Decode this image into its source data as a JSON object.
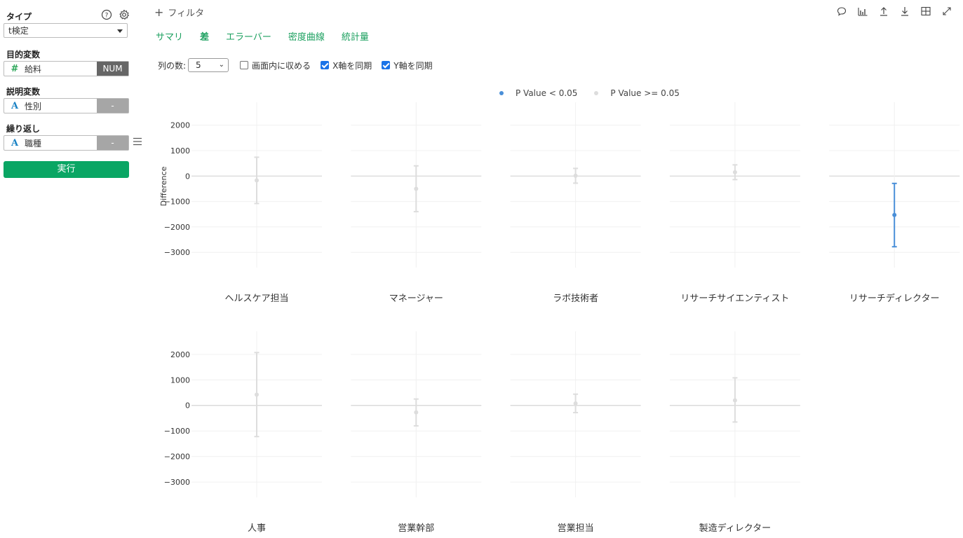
{
  "sidebar": {
    "type_label": "タイプ",
    "type_value": "t検定",
    "target_label": "目的変数",
    "target_field": {
      "name": "給料",
      "tag": "NUM",
      "icon": "#"
    },
    "explanatory_label": "説明変数",
    "explanatory_field": {
      "name": "性別",
      "tag": "-",
      "icon": "A"
    },
    "repeat_label": "繰り返し",
    "repeat_field": {
      "name": "職種",
      "tag": "-",
      "icon": "A"
    },
    "run_label": "実行"
  },
  "filter_label": "フィルタ",
  "tabs": [
    {
      "label": "サマリ",
      "active": false
    },
    {
      "label": "差",
      "active": true
    },
    {
      "label": "エラーバー",
      "active": false
    },
    {
      "label": "密度曲線",
      "active": false
    },
    {
      "label": "統計量",
      "active": false
    }
  ],
  "controls": {
    "columns_label": "列の数:",
    "columns_value": "5",
    "fit_screen_label": "画面内に収める",
    "fit_screen_checked": false,
    "sync_x_label": "X軸を同期",
    "sync_x_checked": true,
    "sync_y_label": "Y軸を同期",
    "sync_y_checked": true
  },
  "legend": [
    {
      "label": "P Value < 0.05",
      "color": "#4a8fd8"
    },
    {
      "label": "P Value >= 0.05",
      "color": "#dddddd"
    }
  ],
  "colors": {
    "significant": "#4a8fd8",
    "not_significant": "#dddddd",
    "accent": "#0aa664"
  },
  "chart_data": {
    "type": "errorbar",
    "ylabel": "Difference",
    "yticks": [
      2000,
      1000,
      0,
      -1000,
      -2000,
      -3000
    ],
    "ytick_labels": [
      "2000",
      "1000",
      "0",
      "−1000",
      "−2000",
      "−3000"
    ],
    "ylim": [
      -3600,
      2900
    ],
    "columns": 5,
    "facets": [
      {
        "name": "ヘルスケア担当",
        "mean": -170,
        "lower": -1080,
        "upper": 740,
        "significant": false
      },
      {
        "name": "マネージャー",
        "mean": -500,
        "lower": -1400,
        "upper": 400,
        "significant": false
      },
      {
        "name": "ラボ技術者",
        "mean": 10,
        "lower": -280,
        "upper": 300,
        "significant": false
      },
      {
        "name": "リサーチサイエンティスト",
        "mean": 150,
        "lower": -140,
        "upper": 440,
        "significant": false
      },
      {
        "name": "リサーチディレクター",
        "mean": -1530,
        "lower": -2780,
        "upper": -290,
        "significant": true
      },
      {
        "name": "人事",
        "mean": 420,
        "lower": -1220,
        "upper": 2070,
        "significant": false
      },
      {
        "name": "営業幹部",
        "mean": -270,
        "lower": -800,
        "upper": 250,
        "significant": false
      },
      {
        "name": "営業担当",
        "mean": 80,
        "lower": -280,
        "upper": 440,
        "significant": false
      },
      {
        "name": "製造ディレクター",
        "mean": 200,
        "lower": -650,
        "upper": 1080,
        "significant": false
      }
    ]
  }
}
